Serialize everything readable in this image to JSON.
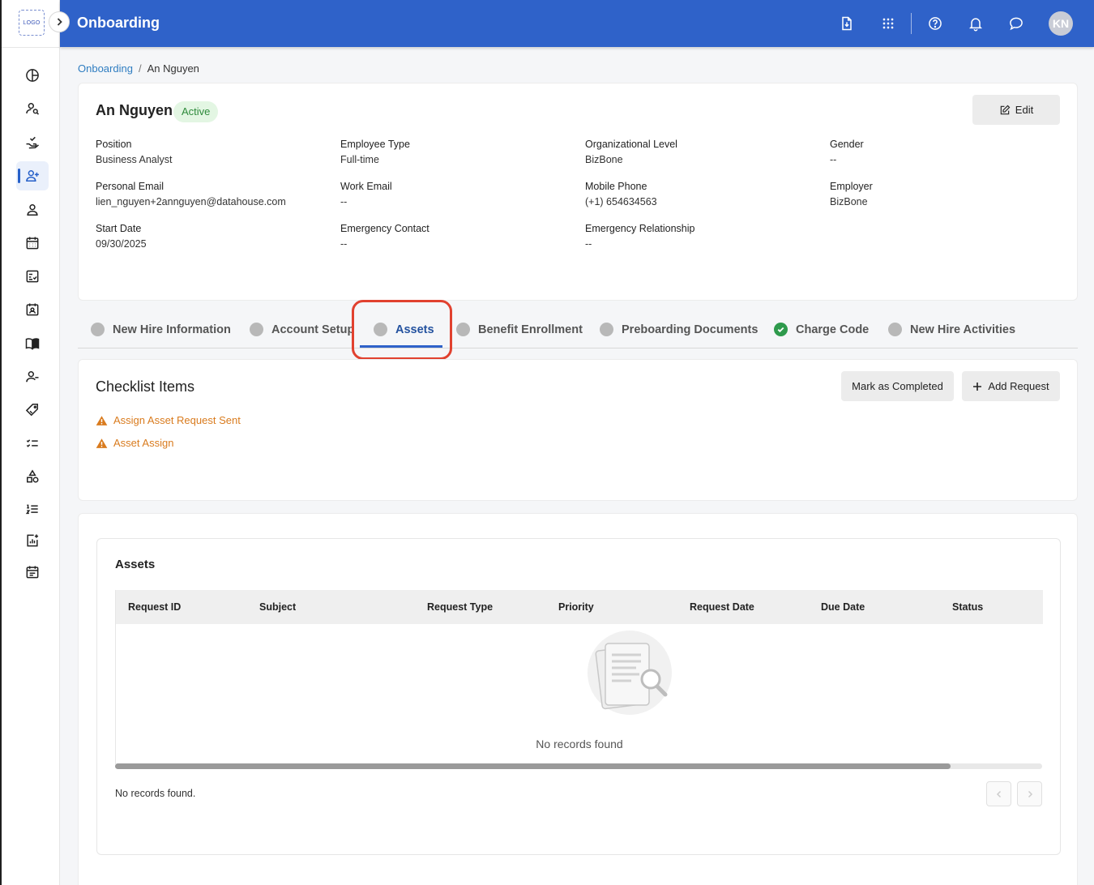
{
  "app": {
    "logo_text": "LOGO",
    "module_title": "Onboarding",
    "user_initials": "KN",
    "colors": {
      "primary": "#2f62c9",
      "active_badge_bg": "#e3f6e3",
      "active_badge_text": "#2e8a3b",
      "warning": "#d97b1e",
      "done": "#2e9a4c",
      "highlight": "#e1412f"
    }
  },
  "topbar": {
    "icons": [
      "download-file-icon",
      "apps-grid-icon",
      "help-icon",
      "bell-icon",
      "chat-icon"
    ]
  },
  "sidebar": {
    "icons": [
      "dashboard-icon",
      "people-search-icon",
      "handshake-check-icon",
      "add-user-icon",
      "person-icon",
      "calendar-icon",
      "checklist-doc-icon",
      "id-card-icon",
      "book-icon",
      "person-minus-icon",
      "tag-icon",
      "task-list-icon",
      "shapes-icon",
      "numbered-list-icon",
      "report-chart-icon",
      "schedule-icon"
    ],
    "active_index": 3
  },
  "breadcrumb": {
    "root": "Onboarding",
    "current": "An Nguyen"
  },
  "employee": {
    "name": "An Nguyen",
    "status": "Active",
    "edit_label": "Edit",
    "fields": {
      "position": {
        "label": "Position",
        "value": "Business Analyst"
      },
      "employee_type": {
        "label": "Employee Type",
        "value": "Full-time"
      },
      "org_level": {
        "label": "Organizational Level",
        "value": "BizBone"
      },
      "gender": {
        "label": "Gender",
        "value": "--"
      },
      "personal_email": {
        "label": "Personal Email",
        "value": "lien_nguyen+2annguyen@datahouse.com"
      },
      "work_email": {
        "label": "Work Email",
        "value": "--"
      },
      "mobile_phone": {
        "label": "Mobile Phone",
        "value": "(+1) 654634563"
      },
      "employer": {
        "label": "Employer",
        "value": "BizBone"
      },
      "start_date": {
        "label": "Start Date",
        "value": "09/30/2025"
      },
      "emergency_contact": {
        "label": "Emergency Contact",
        "value": "--"
      },
      "emergency_relationship": {
        "label": "Emergency Relationship",
        "value": "--"
      }
    }
  },
  "tabs": [
    {
      "label": "New Hire Information",
      "state": "pending"
    },
    {
      "label": "Account Setup",
      "state": "pending"
    },
    {
      "label": "Assets",
      "state": "active"
    },
    {
      "label": "Benefit Enrollment",
      "state": "pending"
    },
    {
      "label": "Preboarding Documents",
      "state": "pending"
    },
    {
      "label": "Charge Code",
      "state": "done"
    },
    {
      "label": "New Hire Activities",
      "state": "pending"
    }
  ],
  "checklist": {
    "title": "Checklist Items",
    "mark_completed_label": "Mark as Completed",
    "add_request_label": "Add Request",
    "items": [
      {
        "label": "Assign Asset Request Sent",
        "status": "warning"
      },
      {
        "label": "Asset Assign",
        "status": "warning"
      }
    ]
  },
  "assets": {
    "title": "Assets",
    "columns": [
      "Request ID",
      "Subject",
      "Request Type",
      "Priority",
      "Request Date",
      "Due Date",
      "Status"
    ],
    "rows": [],
    "empty_message": "No records found",
    "footer_text": "No records found."
  }
}
